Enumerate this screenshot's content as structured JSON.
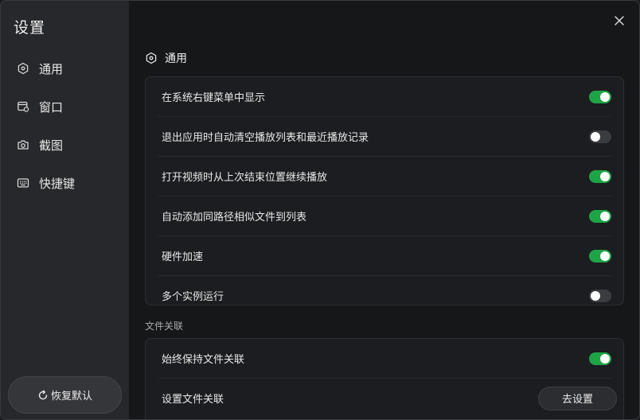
{
  "sidebar": {
    "title": "设置",
    "items": [
      {
        "label": "通用",
        "icon": "hexagon-icon"
      },
      {
        "label": "窗口",
        "icon": "window-icon"
      },
      {
        "label": "截图",
        "icon": "camera-icon"
      },
      {
        "label": "快捷键",
        "icon": "keyboard-icon"
      }
    ],
    "reset_label": "恢复默认"
  },
  "general": {
    "title": "通用",
    "settings": [
      {
        "label": "在系统右键菜单中显示",
        "enabled": true
      },
      {
        "label": "退出应用时自动清空播放列表和最近播放记录",
        "enabled": false
      },
      {
        "label": "打开视频时从上次结束位置继续播放",
        "enabled": true
      },
      {
        "label": "自动添加同路径相似文件到列表",
        "enabled": true
      },
      {
        "label": "硬件加速",
        "enabled": true
      },
      {
        "label": "多个实例运行",
        "enabled": false
      }
    ]
  },
  "file_assoc": {
    "title": "文件关联",
    "always_keep_label": "始终保持文件关联",
    "always_keep_enabled": true,
    "set_label": "设置文件关联",
    "set_button": "去设置"
  },
  "colors": {
    "accent_on": "#1ea446",
    "toggle_off": "#3b3c40"
  }
}
